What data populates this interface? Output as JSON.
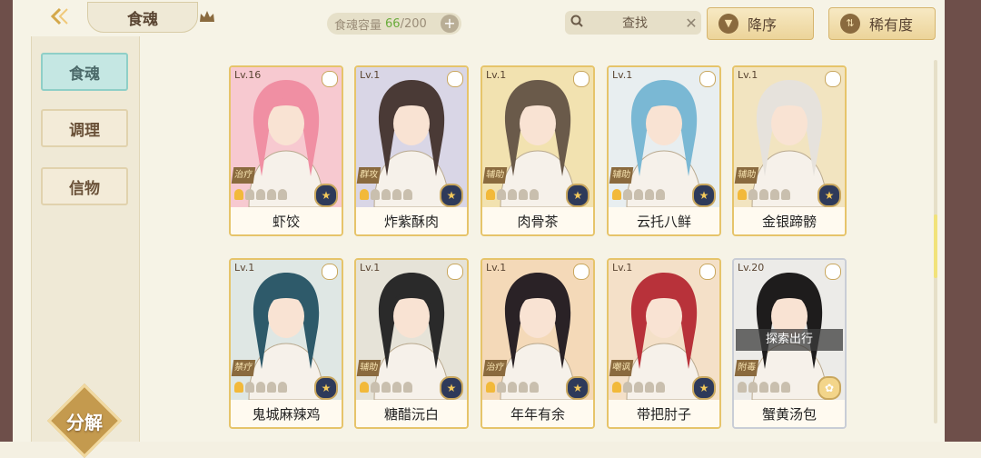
{
  "header": {
    "title": "食魂",
    "capacity_label": "食魂容量",
    "capacity_current": "66",
    "capacity_sep_max": "/200",
    "capacity_add": "+",
    "search_label": "查找",
    "search_clear": "✕",
    "sort_order_label": "降序",
    "sort_order_icon": "▼",
    "sort_by_label": "稀有度",
    "sort_by_icon": "⇅"
  },
  "sidebar": {
    "items": [
      {
        "label": "食魂",
        "active": true
      },
      {
        "label": "调理",
        "active": false
      },
      {
        "label": "信物",
        "active": false
      }
    ],
    "decompose_label": "分解"
  },
  "cards": [
    {
      "level": "Lv.16",
      "role": "治疗",
      "stars": 1,
      "name": "虾饺",
      "rarity_icon": "★",
      "tint": "#f7c9d0",
      "hair": "#f08fa3"
    },
    {
      "level": "Lv.1",
      "role": "群攻",
      "stars": 1,
      "name": "炸紫酥肉",
      "rarity_icon": "★",
      "tint": "#d9d6e6",
      "hair": "#4a3a36"
    },
    {
      "level": "Lv.1",
      "role": "辅助",
      "stars": 1,
      "name": "肉骨茶",
      "rarity_icon": "★",
      "tint": "#f2e2b0",
      "hair": "#6a5a4a"
    },
    {
      "level": "Lv.1",
      "role": "辅助",
      "stars": 1,
      "name": "云托八鲜",
      "rarity_icon": "★",
      "tint": "#e8eef0",
      "hair": "#7ab8d4"
    },
    {
      "level": "Lv.1",
      "role": "辅助",
      "stars": 1,
      "name": "金银蹄髈",
      "rarity_icon": "★",
      "tint": "#f2e4c0",
      "hair": "#e6e2dc"
    },
    {
      "level": "Lv.1",
      "role": "禁疗",
      "stars": 1,
      "name": "鬼城麻辣鸡",
      "rarity_icon": "★",
      "tint": "#dfe7e4",
      "hair": "#2e5a6a"
    },
    {
      "level": "Lv.1",
      "role": "辅助",
      "stars": 1,
      "name": "糖醋沅白",
      "rarity_icon": "★",
      "tint": "#e6e3d8",
      "hair": "#2a2a2a"
    },
    {
      "level": "Lv.1",
      "role": "治疗",
      "stars": 1,
      "name": "年年有余",
      "rarity_icon": "★",
      "tint": "#f4d9b8",
      "hair": "#2a2226"
    },
    {
      "level": "Lv.1",
      "role": "嘲讽",
      "stars": 1,
      "name": "带把肘子",
      "rarity_icon": "★",
      "tint": "#f4e0c8",
      "hair": "#b8323a"
    },
    {
      "level": "Lv.20",
      "role": "附毒",
      "stars": 0,
      "name": "蟹黄汤包",
      "rarity_icon": "✿",
      "tint": "#ecebe8",
      "hair": "#1e1c1c",
      "status": "探索出行",
      "silver": true
    }
  ]
}
